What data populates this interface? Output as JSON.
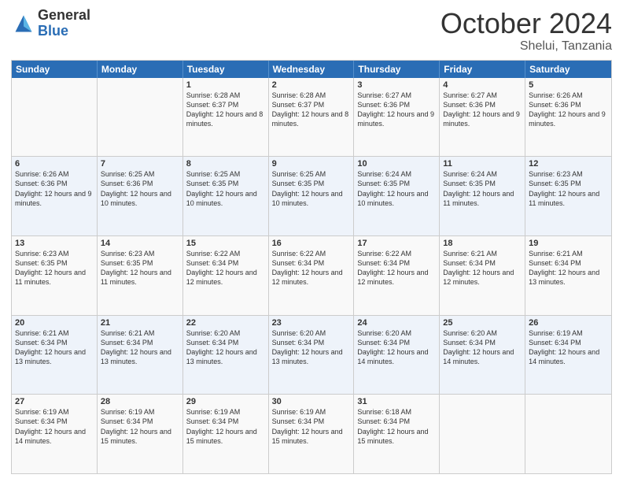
{
  "logo": {
    "general": "General",
    "blue": "Blue"
  },
  "header": {
    "month": "October 2024",
    "location": "Shelui, Tanzania"
  },
  "weekdays": [
    "Sunday",
    "Monday",
    "Tuesday",
    "Wednesday",
    "Thursday",
    "Friday",
    "Saturday"
  ],
  "weeks": [
    [
      {
        "day": "",
        "info": ""
      },
      {
        "day": "",
        "info": ""
      },
      {
        "day": "1",
        "info": "Sunrise: 6:28 AM\nSunset: 6:37 PM\nDaylight: 12 hours and 8 minutes."
      },
      {
        "day": "2",
        "info": "Sunrise: 6:28 AM\nSunset: 6:37 PM\nDaylight: 12 hours and 8 minutes."
      },
      {
        "day": "3",
        "info": "Sunrise: 6:27 AM\nSunset: 6:36 PM\nDaylight: 12 hours and 9 minutes."
      },
      {
        "day": "4",
        "info": "Sunrise: 6:27 AM\nSunset: 6:36 PM\nDaylight: 12 hours and 9 minutes."
      },
      {
        "day": "5",
        "info": "Sunrise: 6:26 AM\nSunset: 6:36 PM\nDaylight: 12 hours and 9 minutes."
      }
    ],
    [
      {
        "day": "6",
        "info": "Sunrise: 6:26 AM\nSunset: 6:36 PM\nDaylight: 12 hours and 9 minutes."
      },
      {
        "day": "7",
        "info": "Sunrise: 6:25 AM\nSunset: 6:36 PM\nDaylight: 12 hours and 10 minutes."
      },
      {
        "day": "8",
        "info": "Sunrise: 6:25 AM\nSunset: 6:35 PM\nDaylight: 12 hours and 10 minutes."
      },
      {
        "day": "9",
        "info": "Sunrise: 6:25 AM\nSunset: 6:35 PM\nDaylight: 12 hours and 10 minutes."
      },
      {
        "day": "10",
        "info": "Sunrise: 6:24 AM\nSunset: 6:35 PM\nDaylight: 12 hours and 10 minutes."
      },
      {
        "day": "11",
        "info": "Sunrise: 6:24 AM\nSunset: 6:35 PM\nDaylight: 12 hours and 11 minutes."
      },
      {
        "day": "12",
        "info": "Sunrise: 6:23 AM\nSunset: 6:35 PM\nDaylight: 12 hours and 11 minutes."
      }
    ],
    [
      {
        "day": "13",
        "info": "Sunrise: 6:23 AM\nSunset: 6:35 PM\nDaylight: 12 hours and 11 minutes."
      },
      {
        "day": "14",
        "info": "Sunrise: 6:23 AM\nSunset: 6:35 PM\nDaylight: 12 hours and 11 minutes."
      },
      {
        "day": "15",
        "info": "Sunrise: 6:22 AM\nSunset: 6:34 PM\nDaylight: 12 hours and 12 minutes."
      },
      {
        "day": "16",
        "info": "Sunrise: 6:22 AM\nSunset: 6:34 PM\nDaylight: 12 hours and 12 minutes."
      },
      {
        "day": "17",
        "info": "Sunrise: 6:22 AM\nSunset: 6:34 PM\nDaylight: 12 hours and 12 minutes."
      },
      {
        "day": "18",
        "info": "Sunrise: 6:21 AM\nSunset: 6:34 PM\nDaylight: 12 hours and 12 minutes."
      },
      {
        "day": "19",
        "info": "Sunrise: 6:21 AM\nSunset: 6:34 PM\nDaylight: 12 hours and 13 minutes."
      }
    ],
    [
      {
        "day": "20",
        "info": "Sunrise: 6:21 AM\nSunset: 6:34 PM\nDaylight: 12 hours and 13 minutes."
      },
      {
        "day": "21",
        "info": "Sunrise: 6:21 AM\nSunset: 6:34 PM\nDaylight: 12 hours and 13 minutes."
      },
      {
        "day": "22",
        "info": "Sunrise: 6:20 AM\nSunset: 6:34 PM\nDaylight: 12 hours and 13 minutes."
      },
      {
        "day": "23",
        "info": "Sunrise: 6:20 AM\nSunset: 6:34 PM\nDaylight: 12 hours and 13 minutes."
      },
      {
        "day": "24",
        "info": "Sunrise: 6:20 AM\nSunset: 6:34 PM\nDaylight: 12 hours and 14 minutes."
      },
      {
        "day": "25",
        "info": "Sunrise: 6:20 AM\nSunset: 6:34 PM\nDaylight: 12 hours and 14 minutes."
      },
      {
        "day": "26",
        "info": "Sunrise: 6:19 AM\nSunset: 6:34 PM\nDaylight: 12 hours and 14 minutes."
      }
    ],
    [
      {
        "day": "27",
        "info": "Sunrise: 6:19 AM\nSunset: 6:34 PM\nDaylight: 12 hours and 14 minutes."
      },
      {
        "day": "28",
        "info": "Sunrise: 6:19 AM\nSunset: 6:34 PM\nDaylight: 12 hours and 15 minutes."
      },
      {
        "day": "29",
        "info": "Sunrise: 6:19 AM\nSunset: 6:34 PM\nDaylight: 12 hours and 15 minutes."
      },
      {
        "day": "30",
        "info": "Sunrise: 6:19 AM\nSunset: 6:34 PM\nDaylight: 12 hours and 15 minutes."
      },
      {
        "day": "31",
        "info": "Sunrise: 6:18 AM\nSunset: 6:34 PM\nDaylight: 12 hours and 15 minutes."
      },
      {
        "day": "",
        "info": ""
      },
      {
        "day": "",
        "info": ""
      }
    ]
  ]
}
